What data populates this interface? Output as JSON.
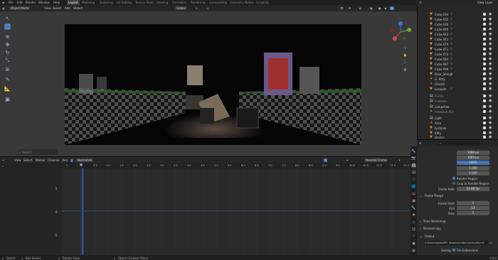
{
  "top_menu": {
    "items": [
      "File",
      "Edit",
      "Render",
      "Window",
      "Help"
    ],
    "tabs": [
      "Layout",
      "Modeling",
      "Sculpting",
      "UV Editing",
      "Texture Paint",
      "Shading",
      "Animation",
      "Rendering",
      "Compositing",
      "Geometry Nodes",
      "Scripting"
    ],
    "active_tab": "Layout"
  },
  "viewport_header": {
    "mode": "Object Mode",
    "menus": [
      "View",
      "Select",
      "Add",
      "Object"
    ],
    "transform": "Global",
    "options": "Options"
  },
  "viewport": {
    "search_placeholder": "Search",
    "gizmo_axes": [
      "X",
      "Y",
      "Z"
    ],
    "colors": {
      "x": "#d8474e",
      "y": "#6fa43b",
      "z": "#3c6fd8"
    }
  },
  "timeline_header": {
    "menus": [
      "View",
      "Select",
      "Marker",
      "Channel",
      "Key"
    ],
    "normalize": "Normalize",
    "interp": "Nearest Frame"
  },
  "timeline": {
    "ruler": [
      "0",
      "0.5",
      "1.0",
      "1.5",
      "2.0",
      "2.5",
      "3.0",
      "3.5",
      "4.0",
      "4.5",
      "5.0",
      "5.5",
      "6.0",
      "6.5",
      "7.0",
      "7.5",
      "8.0",
      "8.5",
      "9.0",
      "9.5",
      "10.0",
      "10.5",
      "11.0",
      "11.5",
      "12.0",
      "12.5"
    ],
    "current_frame": "0",
    "y_labels": [
      "5",
      "0",
      "-5"
    ]
  },
  "statusbar": {
    "items": [
      "Select",
      "Box Select",
      "Rotate View",
      "Object Context Menu"
    ],
    "version": "3.6.0"
  },
  "outliner": {
    "title": "View Layer",
    "rows": [
      {
        "label": "Cube.034",
        "icon": "mesh-icon"
      },
      {
        "label": "Cube.035",
        "icon": "mesh-icon"
      },
      {
        "label": "Cube.036",
        "icon": "mesh-icon"
      },
      {
        "label": "Cube.040",
        "icon": "mesh-icon"
      },
      {
        "label": "Cube.042",
        "icon": "mesh-icon"
      },
      {
        "label": "Cube.043",
        "icon": "mesh-icon"
      },
      {
        "label": "Cube.070",
        "icon": "mesh-icon"
      },
      {
        "label": "Cube.071",
        "icon": "mesh-icon"
      },
      {
        "label": "Cube.072",
        "icon": "mesh-icon"
      },
      {
        "label": "Cube.084",
        "icon": "mesh-icon"
      },
      {
        "label": "Cube.087",
        "icon": "mesh-icon"
      },
      {
        "label": "Cube.090",
        "icon": "mesh-icon"
      },
      {
        "label": "Door_Shinge",
        "icon": "mesh-icon"
      },
      {
        "label": "G. Kitty",
        "icon": "armature-icon"
      },
      {
        "label": "Ghost2",
        "icon": "armature-icon"
      },
      {
        "label": "Lockpile",
        "icon": "mesh-icon"
      },
      {
        "label": "Purble",
        "icon": "collection-icon"
      },
      {
        "label": "Freakies",
        "icon": "collection-icon"
      },
      {
        "label": "Lampshoe",
        "icon": "collection-icon"
      },
      {
        "label": "Freakbob.001",
        "icon": "armature-icon"
      },
      {
        "label": "Light",
        "icon": "light-icon"
      },
      {
        "label": "Area",
        "icon": "light-icon"
      },
      {
        "label": "Lockpile",
        "icon": "mesh-icon"
      },
      {
        "label": "Kitty",
        "icon": "mesh-icon"
      },
      {
        "label": "Device",
        "icon": "mesh-icon"
      }
    ]
  },
  "properties": {
    "resolution_x": "1080 px",
    "resolution_y": "1080 px",
    "percent": "100%",
    "aspect_x": "1.000",
    "aspect_y": "1.000",
    "render_region": "Render Region",
    "crop": "Crop to Render Region",
    "frame_rate_label": "Frame Rate",
    "frame_rate": "23.98 fps",
    "frame_range": "Frame Range",
    "frame_start_label": "Frame Start",
    "frame_start": "1",
    "end_label": "End",
    "end": "13",
    "step_label": "Step",
    "step": "1",
    "time_stretching": "Time Stretching",
    "stereoscopy": "Stereoscopy",
    "output": "Output",
    "output_path": "D:\\Downloads\\DPS Models\\renders\\animoff\\xn%",
    "saving_label": "Saving",
    "file_extensions": "File Extensions"
  }
}
